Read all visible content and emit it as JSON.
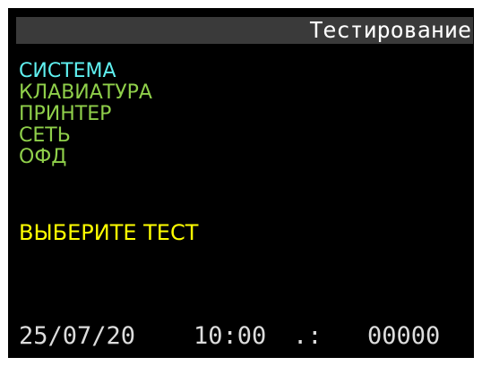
{
  "header": {
    "title": "Тестирование"
  },
  "menu": {
    "items": [
      {
        "label": "СИСТЕМА",
        "color": "#5ff0f0",
        "selected": true
      },
      {
        "label": "КЛАВИАТУРА",
        "color": "#8fcf4a",
        "selected": false
      },
      {
        "label": "ПРИНТЕР",
        "color": "#8fcf4a",
        "selected": false
      },
      {
        "label": "СЕТЬ",
        "color": "#8fcf4a",
        "selected": false
      },
      {
        "label": "ОФД",
        "color": "#8fcf4a",
        "selected": false
      }
    ]
  },
  "prompt": {
    "text": "ВЫБЕРИТЕ ТЕСТ",
    "color": "#ffff00"
  },
  "status": {
    "date": "25/07/20",
    "time": "10:00",
    "separator": ".:",
    "counter": "00000"
  },
  "colors": {
    "background": "#000000",
    "header_bar": "#3a3a3a",
    "header_text": "#ffffff",
    "status_text": "#dcdcdc"
  }
}
